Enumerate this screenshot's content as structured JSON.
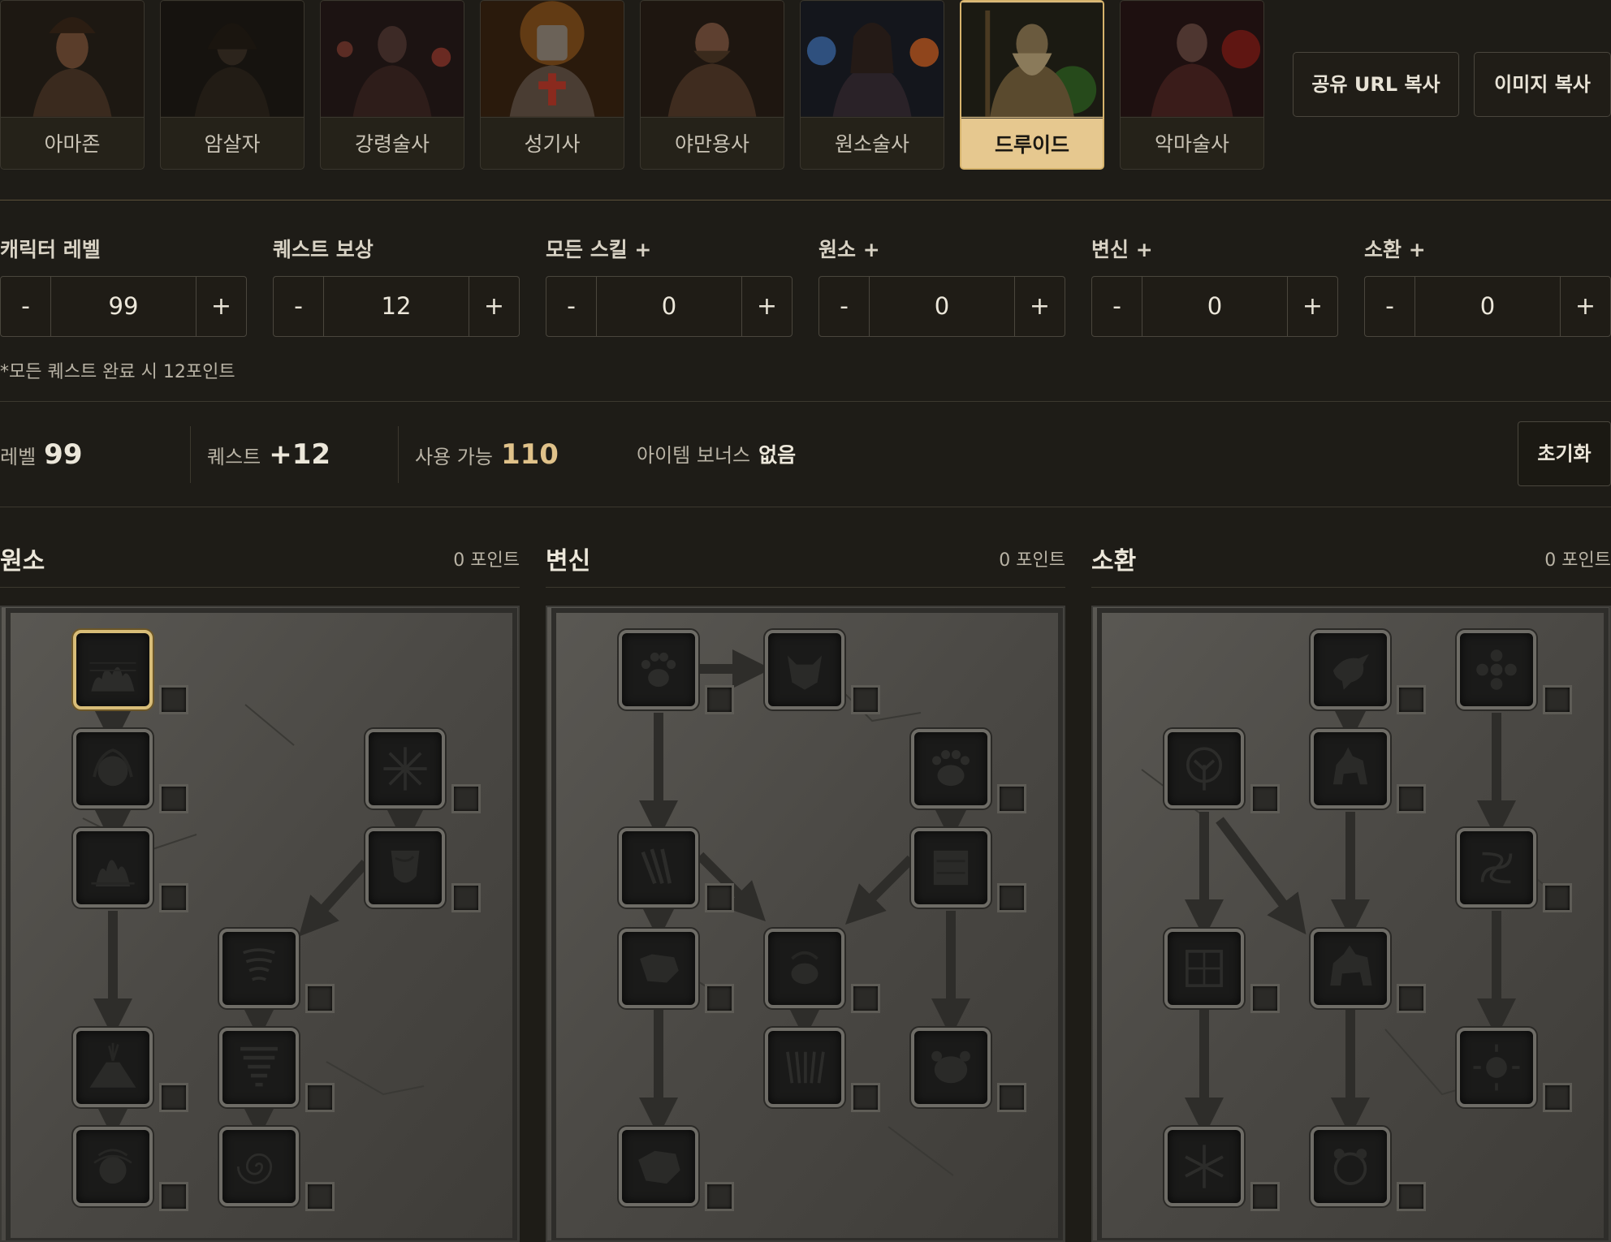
{
  "classes": [
    {
      "label": "아마존",
      "icon": "amazon-portrait",
      "active": false
    },
    {
      "label": "암살자",
      "icon": "assassin-portrait",
      "active": false
    },
    {
      "label": "강령술사",
      "icon": "necromancer-portrait",
      "active": false
    },
    {
      "label": "성기사",
      "icon": "paladin-portrait",
      "active": false
    },
    {
      "label": "야만용사",
      "icon": "barbarian-portrait",
      "active": false
    },
    {
      "label": "원소술사",
      "icon": "sorceress-portrait",
      "active": false
    },
    {
      "label": "드루이드",
      "icon": "druid-portrait",
      "active": true
    },
    {
      "label": "악마술사",
      "icon": "warlock-portrait",
      "active": false
    }
  ],
  "actions": {
    "share_url": "공유 URL 복사",
    "copy_image": "이미지 복사"
  },
  "steppers": [
    {
      "label": "캐릭터 레벨",
      "value": "99"
    },
    {
      "label": "퀘스트 보상",
      "value": "12"
    },
    {
      "label": "모든 스킬 +",
      "value": "0"
    },
    {
      "label": "원소 +",
      "value": "0"
    },
    {
      "label": "변신 +",
      "value": "0"
    },
    {
      "label": "소환 +",
      "value": "0"
    }
  ],
  "stepper_minus": "-",
  "stepper_plus": "+",
  "footnote": "*모든 퀘스트 완료 시 12포인트",
  "summary": {
    "level_label": "레벨",
    "level_value": "99",
    "quest_label": "퀘스트",
    "quest_value": "+12",
    "available_label": "사용 가능",
    "available_value": "110",
    "item_bonus_label": "아이템 보너스",
    "item_bonus_value": "없음",
    "reset": "초기화"
  },
  "trees": [
    {
      "name": "원소",
      "points": "0 포인트",
      "skill_count": 10
    },
    {
      "name": "변신",
      "points": "0 포인트",
      "skill_count": 10
    },
    {
      "name": "소환",
      "points": "0 포인트",
      "skill_count": 10
    }
  ],
  "colors": {
    "accent": "#e3c48a",
    "background": "#1e1c17",
    "gold_text": "#e0c28a"
  }
}
